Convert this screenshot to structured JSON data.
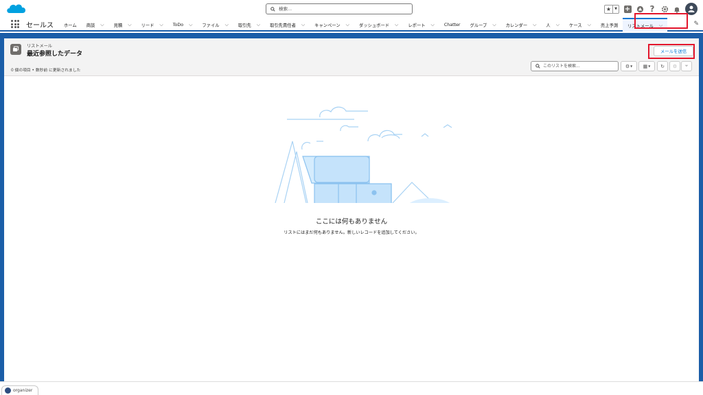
{
  "header": {
    "search_placeholder": "検索..."
  },
  "nav": {
    "app_name": "セールス",
    "items": [
      {
        "label": "ホーム",
        "chevron": false
      },
      {
        "label": "商談",
        "chevron": true
      },
      {
        "label": "見積",
        "chevron": true
      },
      {
        "label": "リード",
        "chevron": true
      },
      {
        "label": "ToDo",
        "chevron": true
      },
      {
        "label": "ファイル",
        "chevron": true
      },
      {
        "label": "取引先",
        "chevron": true
      },
      {
        "label": "取引先責任者",
        "chevron": true
      },
      {
        "label": "キャンペーン",
        "chevron": true
      },
      {
        "label": "ダッシュボード",
        "chevron": true
      },
      {
        "label": "レポート",
        "chevron": true
      },
      {
        "label": "Chatter",
        "chevron": false
      },
      {
        "label": "グループ",
        "chevron": true
      },
      {
        "label": "カレンダー",
        "chevron": true
      },
      {
        "label": "人",
        "chevron": true
      },
      {
        "label": "ケース",
        "chevron": true
      },
      {
        "label": "売上予測",
        "chevron": false
      },
      {
        "label": "リストメール",
        "chevron": true,
        "active": true
      }
    ]
  },
  "list": {
    "object_label": "リストメール",
    "title": "最近参照したデータ",
    "meta": "0 個の項目 • 数秒前 に更新されました",
    "send_button": "メールを送信",
    "search_placeholder": "このリストを検索..."
  },
  "empty": {
    "title": "ここには何もありません",
    "subtitle": "リストにはまだ何もありません。新しいレコードを追加してください。"
  },
  "utility": {
    "organizer_label": "organizer"
  },
  "colors": {
    "brand_blue": "#1b5ea8",
    "accent": "#0176d3",
    "highlight_red": "#e3152b"
  }
}
